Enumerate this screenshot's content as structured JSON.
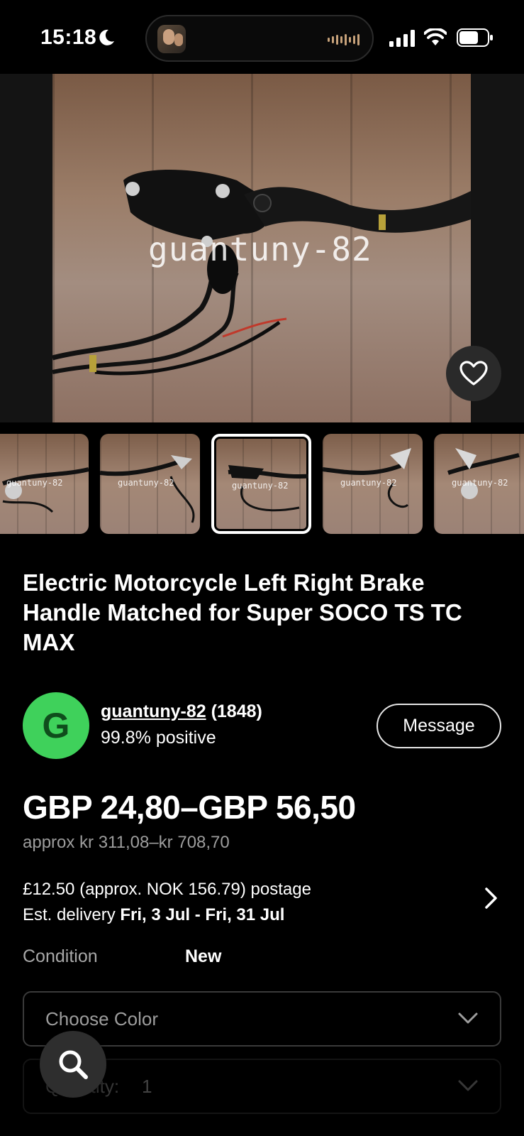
{
  "status_bar": {
    "time": "15:18",
    "icons": [
      "moon-icon",
      "signal-icon",
      "wifi-icon",
      "battery-icon"
    ]
  },
  "gallery": {
    "watermark": "guantuny-82",
    "thumbnail_count": 5,
    "selected_index": 2,
    "favorite_icon": "heart-outline-icon"
  },
  "listing": {
    "title": "Electric Motorcycle Left Right Brake Handle Matched for Super SOCO TS TC MAX"
  },
  "seller": {
    "avatar_letter": "G",
    "name": "guantuny-82",
    "feedback_count": "(1848)",
    "rating": "99.8% positive",
    "message_label": "Message",
    "avatar_color": "#3fd15b"
  },
  "price": {
    "range": "GBP 24,80–GBP 56,50",
    "approx": "approx kr 311,08–kr 708,70"
  },
  "shipping": {
    "postage": "£12.50 (approx. NOK 156.79) postage",
    "delivery_prefix": "Est. delivery ",
    "delivery_dates": "Fri, 3 Jul - Fri, 31 Jul"
  },
  "condition": {
    "label": "Condition",
    "value": "New"
  },
  "options": {
    "color_placeholder": "Choose Color",
    "quantity_label": "Quantity:",
    "quantity_value": "1"
  },
  "search_fab_icon": "search-icon"
}
